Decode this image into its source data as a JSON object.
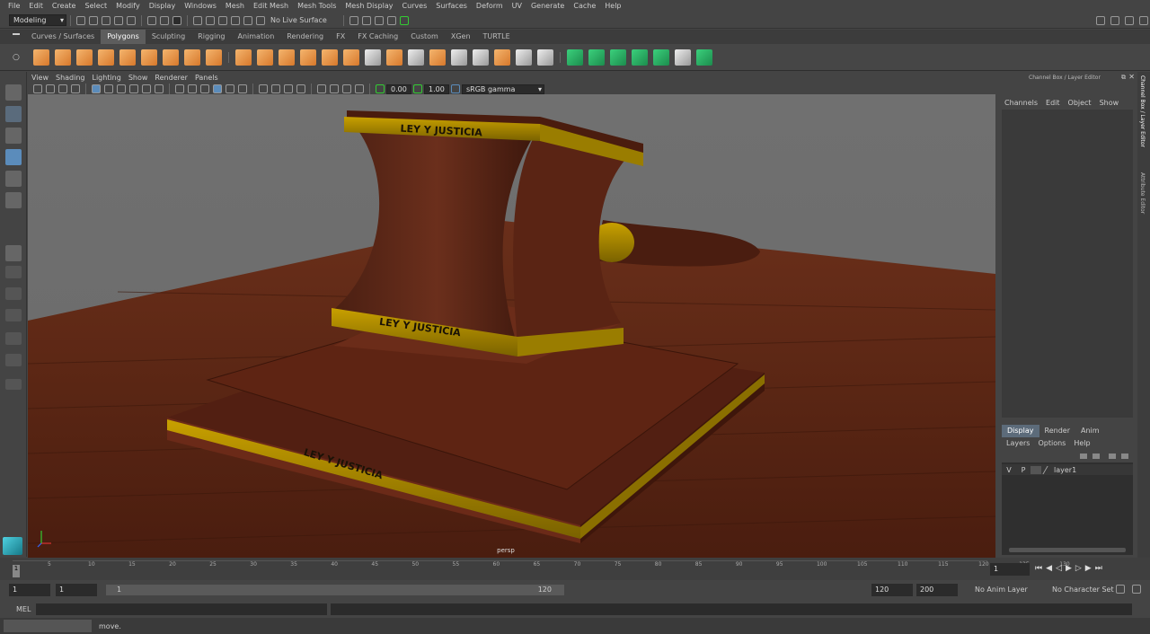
{
  "menubar": [
    "File",
    "Edit",
    "Create",
    "Select",
    "Modify",
    "Display",
    "Windows",
    "Mesh",
    "Edit Mesh",
    "Mesh Tools",
    "Mesh Display",
    "Curves",
    "Surfaces",
    "Deform",
    "UV",
    "Generate",
    "Cache",
    "Help"
  ],
  "status": {
    "mode": "Modeling",
    "live_surface": "No Live Surface"
  },
  "shelf_tabs": [
    "Curves / Surfaces",
    "Polygons",
    "Sculpting",
    "Rigging",
    "Animation",
    "Rendering",
    "FX",
    "FX Caching",
    "Custom",
    "XGen",
    "TURTLE"
  ],
  "viewport_menu": [
    "View",
    "Shading",
    "Lighting",
    "Show",
    "Renderer",
    "Panels"
  ],
  "viewport_tools": {
    "value_a": "0.00",
    "value_b": "1.00",
    "color_space": "sRGB gamma"
  },
  "scene": {
    "engraving": "LEY Y JUSTICIA",
    "camera": "persp"
  },
  "channel_box": {
    "title": "Channel Box / Layer Editor",
    "menu": [
      "Channels",
      "Edit",
      "Object",
      "Show"
    ],
    "tabs": [
      "Display",
      "Render",
      "Anim"
    ],
    "layer_menu": [
      "Layers",
      "Options",
      "Help"
    ],
    "layer": {
      "v": "V",
      "p": "P",
      "name": "layer1"
    }
  },
  "side_tabs": [
    "Channel Box / Layer Editor",
    "Attribute Editor"
  ],
  "timeline": {
    "ticks": [
      "5",
      "10",
      "15",
      "20",
      "25",
      "30",
      "35",
      "40",
      "45",
      "50",
      "55",
      "60",
      "65",
      "70",
      "75",
      "80",
      "85",
      "90",
      "95",
      "100",
      "105",
      "110",
      "115",
      "120",
      "125",
      "130"
    ],
    "current_frame": "1"
  },
  "range": {
    "start": "1",
    "start_inner": "1",
    "slider_start": "1",
    "slider_end": "120",
    "end": "120",
    "end_outer": "200",
    "anim_layer": "No Anim Layer",
    "char_set": "No Character Set"
  },
  "commandline": {
    "label": "MEL"
  },
  "helpline": {
    "text": "move."
  }
}
